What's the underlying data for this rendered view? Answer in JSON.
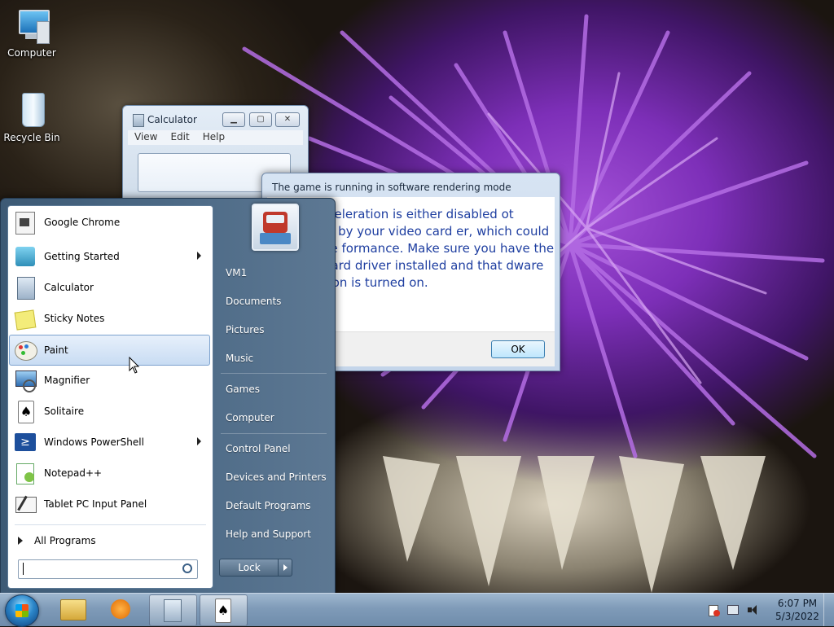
{
  "desktop": {
    "icons": [
      {
        "label": "Computer",
        "icon": "computer-icon"
      },
      {
        "label": "Recycle Bin",
        "icon": "recycle-bin-icon"
      }
    ]
  },
  "calculator": {
    "title": "Calculator",
    "menu": [
      "View",
      "Edit",
      "Help"
    ]
  },
  "dialog": {
    "title": "The game is running in software rendering mode",
    "message": "dware acceleration is either disabled ot supported by your video card er, which could slow game formance. Make sure you have the st video card driver installed and that dware acceleration is turned on.",
    "ok_label": "OK"
  },
  "start_menu": {
    "programs": [
      {
        "label": "Google Chrome",
        "icon": "chrome-icon",
        "submenu": false
      },
      {
        "label": "Getting Started",
        "icon": "getting-started-icon",
        "submenu": true
      },
      {
        "label": "Calculator",
        "icon": "calculator-icon",
        "submenu": false
      },
      {
        "label": "Sticky Notes",
        "icon": "sticky-notes-icon",
        "submenu": false
      },
      {
        "label": "Paint",
        "icon": "paint-icon",
        "submenu": false,
        "highlighted": true
      },
      {
        "label": "Magnifier",
        "icon": "magnifier-icon",
        "submenu": false
      },
      {
        "label": "Solitaire",
        "icon": "solitaire-icon",
        "submenu": false
      },
      {
        "label": "Windows PowerShell",
        "icon": "powershell-icon",
        "submenu": true
      },
      {
        "label": "Notepad++",
        "icon": "notepad-plus-plus-icon",
        "submenu": false
      },
      {
        "label": "Tablet PC Input Panel",
        "icon": "tablet-input-icon",
        "submenu": false
      }
    ],
    "all_programs_label": "All Programs",
    "search_value": "",
    "right_items": [
      "VM1",
      "Documents",
      "Pictures",
      "Music",
      "Games",
      "Computer",
      "Control Panel",
      "Devices and Printers",
      "Default Programs",
      "Help and Support"
    ],
    "lock_label": "Lock"
  },
  "taskbar": {
    "pinned": [
      "explorer-icon",
      "media-player-icon",
      "calculator-icon",
      "solitaire-icon"
    ],
    "clock_time": "6:07 PM",
    "clock_date": "5/3/2022"
  },
  "colors": {
    "dialog_text": "#1e3ea0",
    "start_menu_right": "#4f6c88",
    "taskbar": "#7f9bb8",
    "accent_purple": "#9a42d2"
  }
}
